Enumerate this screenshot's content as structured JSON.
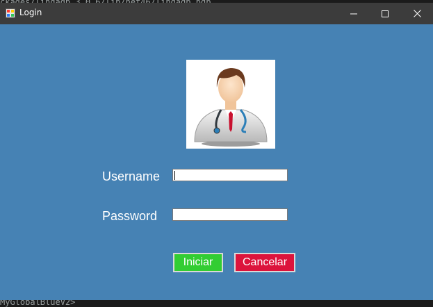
{
  "background": {
    "top_text": "ckages/lingadb_3.0.6/lib/net46/lingadb.pdb",
    "bottom_text": "MyGlobalBlueV2>"
  },
  "window": {
    "title": "Login",
    "icons": {
      "app": "app-form-icon",
      "minimize": "minimize-icon",
      "maximize": "maximize-icon",
      "close": "close-icon"
    }
  },
  "form": {
    "avatar_icon": "doctor-avatar-icon",
    "username_label": "Username",
    "password_label": "Password",
    "username_value": "",
    "password_value": "",
    "login_button": "Iniciar",
    "cancel_button": "Cancelar"
  },
  "colors": {
    "window_bg": "#4682b4",
    "titlebar_bg": "#3c3c3c",
    "login_button": "#32cd32",
    "cancel_button": "#dc143c"
  }
}
